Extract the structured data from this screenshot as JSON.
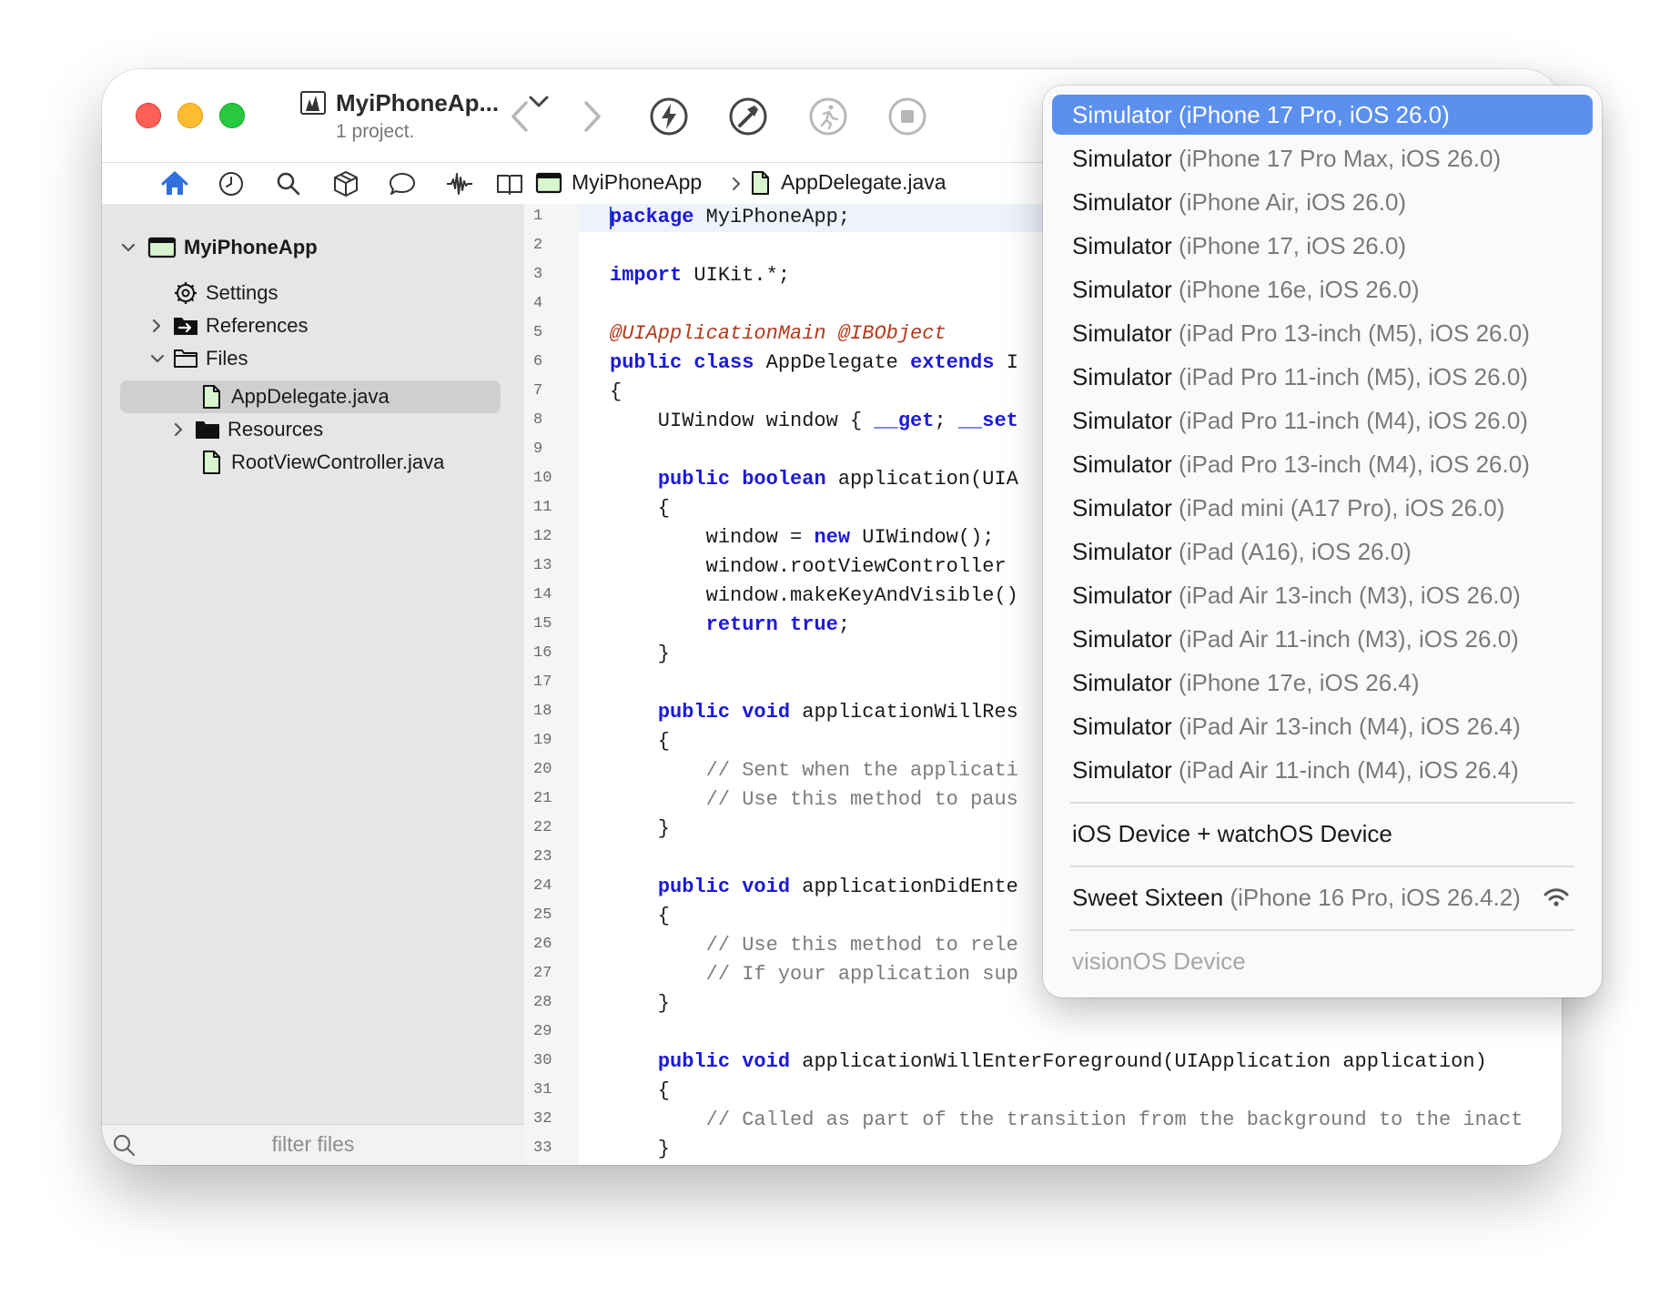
{
  "project": {
    "title": "MyiPhoneAp...",
    "subtitle": "1 project."
  },
  "jump_bar": {
    "project": "MyiPhoneApp",
    "file": "AppDelegate.java"
  },
  "sidebar": {
    "root": "MyiPhoneApp",
    "items": [
      {
        "label": "Settings"
      },
      {
        "label": "References"
      },
      {
        "label": "Files"
      },
      {
        "label": "AppDelegate.java"
      },
      {
        "label": "Resources"
      },
      {
        "label": "RootViewController.java"
      }
    ],
    "filter_placeholder": "filter files"
  },
  "editor": {
    "line_numbers": [
      "1",
      "2",
      "3",
      "4",
      "5",
      "6",
      "7",
      "8",
      "9",
      "10",
      "11",
      "12",
      "13",
      "14",
      "15",
      "16",
      "17",
      "18",
      "19",
      "20",
      "21",
      "22",
      "23",
      "24",
      "25",
      "26",
      "27",
      "28",
      "29",
      "30",
      "31",
      "32",
      "33"
    ],
    "lines": {
      "l1_kw": "package",
      "l1_rest": " MyiPhoneApp;",
      "l3_kw": "import",
      "l3_rest": " UIKit.*;",
      "l5_ann": "@UIApplicationMain @IBObject",
      "l6_kw1": "public class",
      "l6_mid": " AppDelegate ",
      "l6_kw2": "extends",
      "l6_rest": " I",
      "l7": "{",
      "l8_pre": "    UIWindow window { ",
      "l8_kw1": "__get",
      "l8_mid": "; ",
      "l8_kw2": "__set",
      "l10_pre": "    ",
      "l10_kw": "public boolean",
      "l10_rest": " application(UIA",
      "l11": "    {",
      "l12_pre": "        window = ",
      "l12_kw": "new",
      "l12_rest": " UIWindow();",
      "l13": "        window.rootViewController",
      "l14": "        window.makeKeyAndVisible()",
      "l15_pre": "        ",
      "l15_kw": "return true",
      "l15_rest": ";",
      "l16": "    }",
      "l18_pre": "    ",
      "l18_kw": "public void",
      "l18_rest": " applicationWillRes",
      "l19": "    {",
      "l20": "        // Sent when the applicati",
      "l21": "        // Use this method to paus",
      "l22": "    }",
      "l24_pre": "    ",
      "l24_kw": "public void",
      "l24_rest": " applicationDidEnte",
      "l25": "    {",
      "l26": "        // Use this method to rele",
      "l27": "        // If your application sup",
      "l28": "    }",
      "l30_pre": "    ",
      "l30_kw": "public void",
      "l30_rest": " applicationWillEnterForeground(UIApplication application)",
      "l31": "    {",
      "l32": "        // Called as part of the transition from the background to the inact",
      "l33": "    }"
    }
  },
  "device_menu": {
    "items": [
      {
        "main": "Simulator",
        "detail": " (iPhone 17 Pro, iOS 26.0)"
      },
      {
        "main": "Simulator",
        "detail": " (iPhone 17 Pro Max, iOS 26.0)"
      },
      {
        "main": "Simulator",
        "detail": " (iPhone Air, iOS 26.0)"
      },
      {
        "main": "Simulator",
        "detail": " (iPhone 17, iOS 26.0)"
      },
      {
        "main": "Simulator",
        "detail": " (iPhone 16e, iOS 26.0)"
      },
      {
        "main": "Simulator",
        "detail": " (iPad Pro 13-inch (M5), iOS 26.0)"
      },
      {
        "main": "Simulator",
        "detail": " (iPad Pro 11-inch (M5), iOS 26.0)"
      },
      {
        "main": "Simulator",
        "detail": " (iPad Pro 11-inch (M4), iOS 26.0)"
      },
      {
        "main": "Simulator",
        "detail": " (iPad Pro 13-inch (M4), iOS 26.0)"
      },
      {
        "main": "Simulator",
        "detail": " (iPad mini (A17 Pro), iOS 26.0)"
      },
      {
        "main": "Simulator",
        "detail": " (iPad (A16), iOS 26.0)"
      },
      {
        "main": "Simulator",
        "detail": " (iPad Air 13-inch (M3), iOS 26.0)"
      },
      {
        "main": "Simulator",
        "detail": " (iPad Air 11-inch (M3), iOS 26.0)"
      },
      {
        "main": "Simulator",
        "detail": " (iPhone 17e, iOS 26.4)"
      },
      {
        "main": "Simulator",
        "detail": " (iPad Air 13-inch (M4), iOS 26.4)"
      },
      {
        "main": "Simulator",
        "detail": " (iPad Air 11-inch (M4), iOS 26.4)"
      }
    ],
    "group_device": "iOS Device + watchOS Device",
    "physical": {
      "main": "Sweet Sixteen",
      "detail": " (iPhone 16 Pro, iOS 26.4.2)"
    },
    "disabled": "visionOS Device",
    "selected_index": 0
  },
  "colors": {
    "accent": "#5b90ef",
    "keyword": "#1b1ad8",
    "annotation": "#b43a1e",
    "comment": "#7c7c7c"
  }
}
